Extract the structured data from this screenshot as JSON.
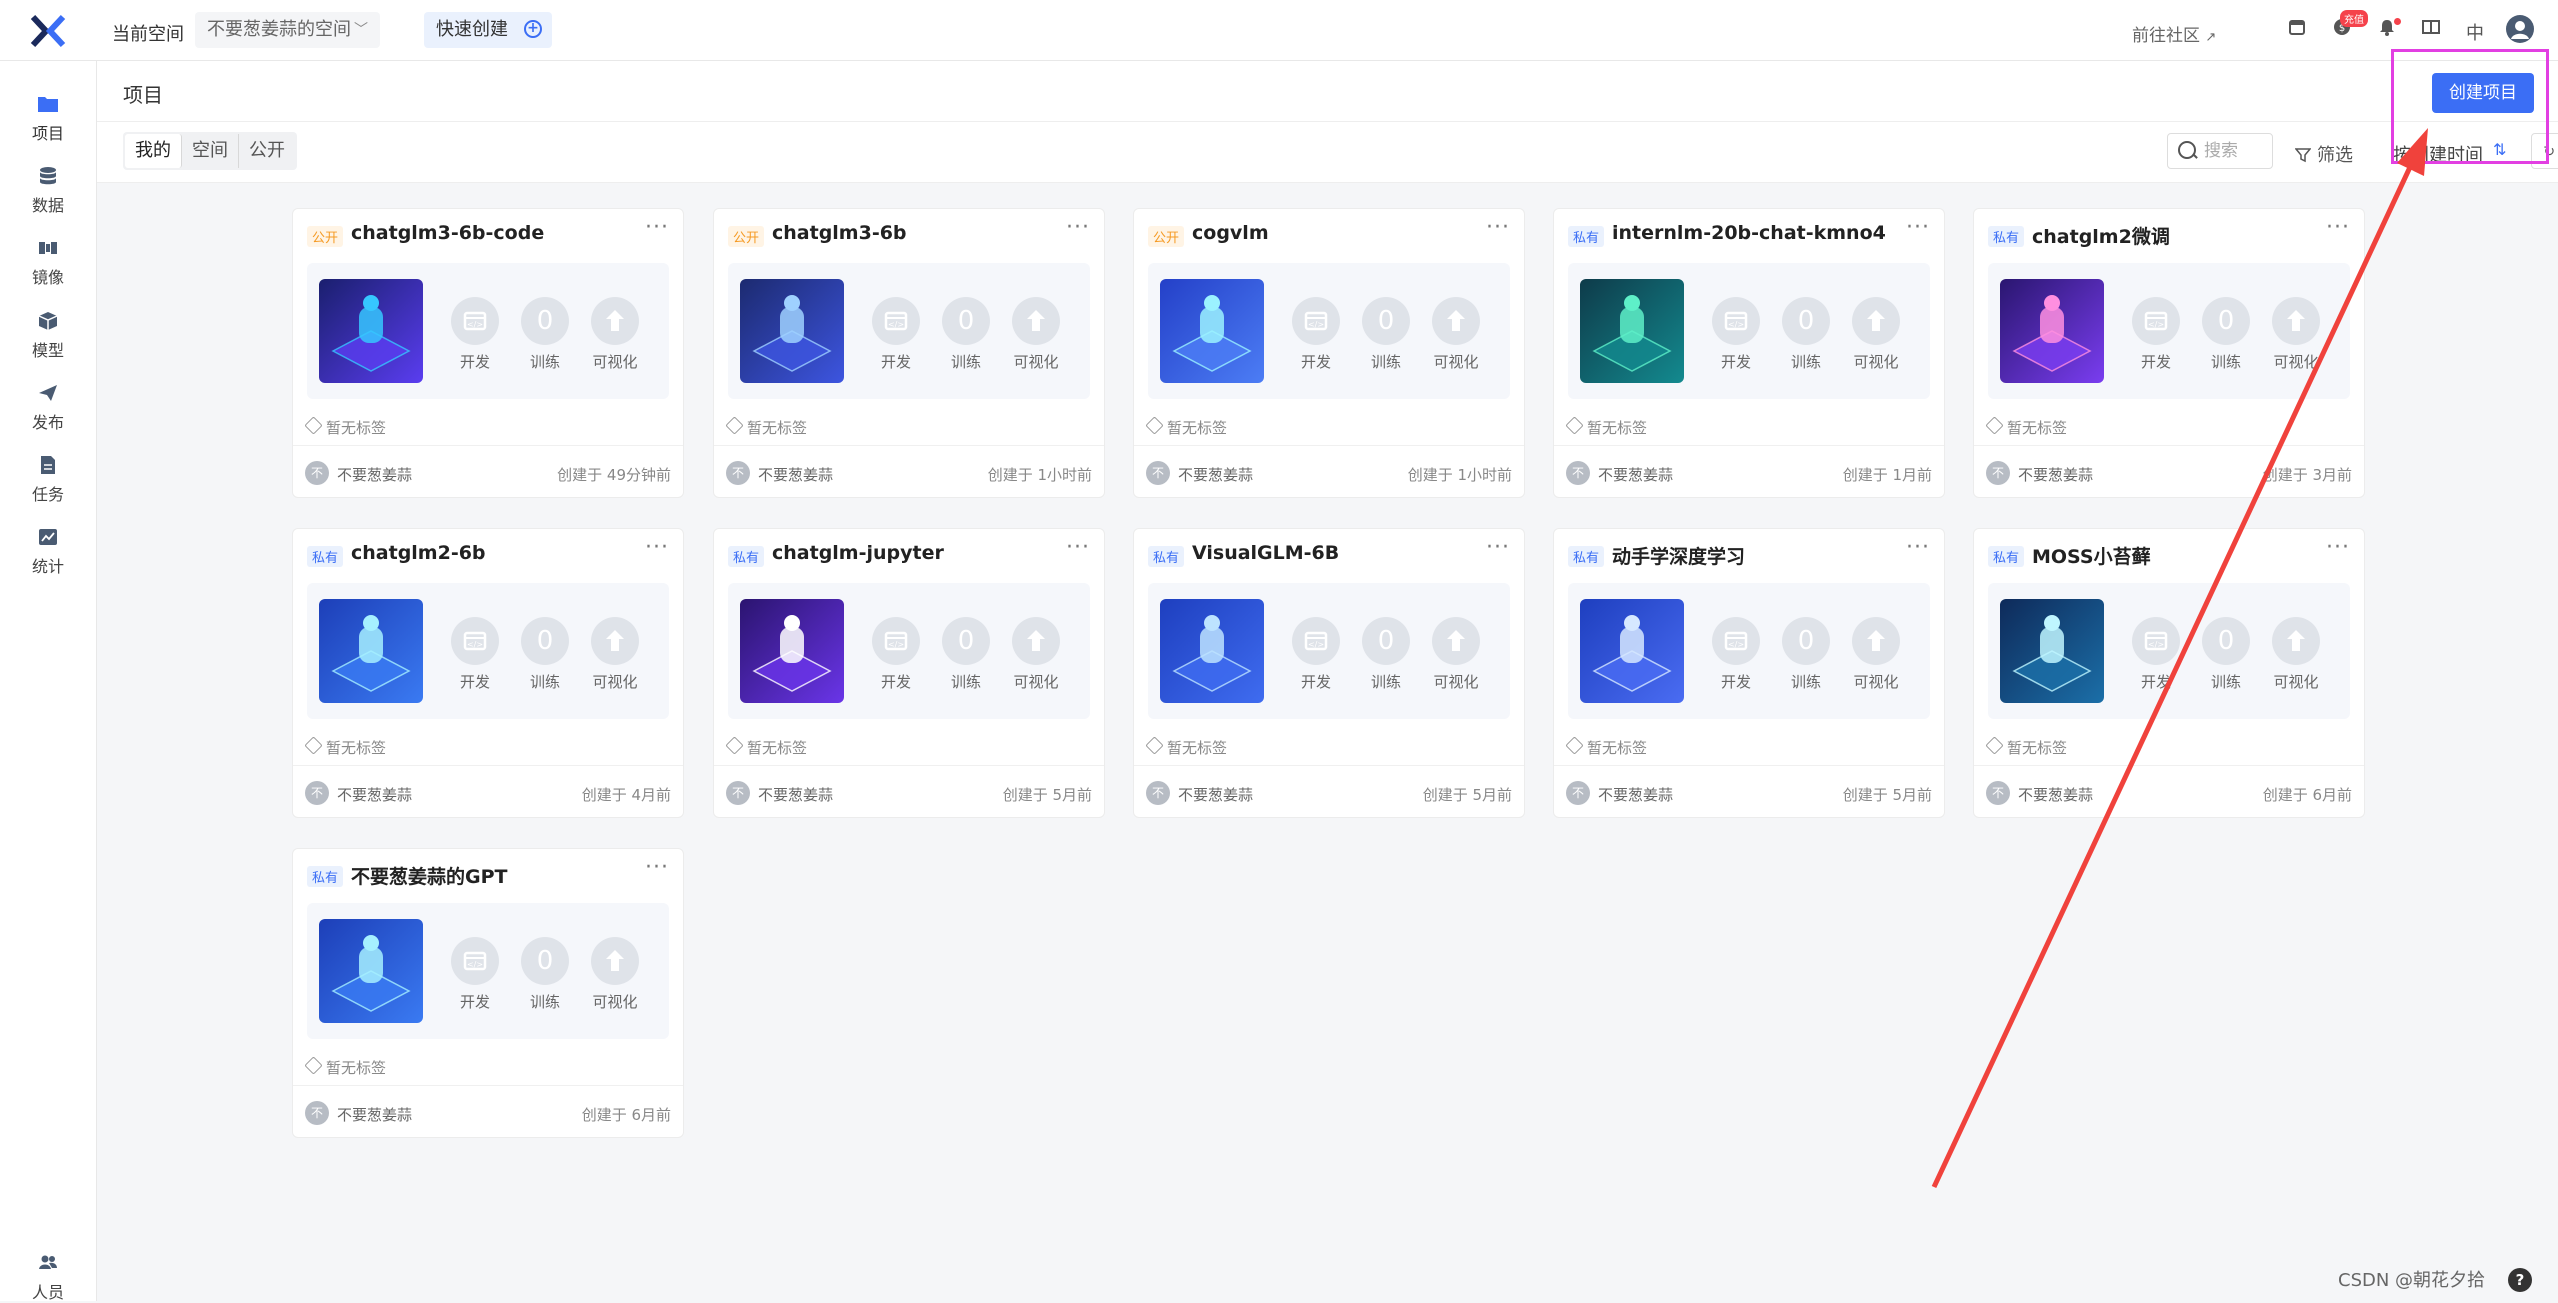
{
  "topbar": {
    "space_label": "当前空间",
    "space_value": "不要葱姜蒜的空间",
    "quick_create": "快速创建",
    "community_link": "前往社区",
    "recharge_badge": "充值",
    "lang": "中"
  },
  "sidebar": {
    "items": [
      {
        "label": "项目",
        "icon": "folder-icon"
      },
      {
        "label": "数据",
        "icon": "database-icon"
      },
      {
        "label": "镜像",
        "icon": "image-icon"
      },
      {
        "label": "模型",
        "icon": "cube-icon"
      },
      {
        "label": "发布",
        "icon": "send-icon"
      },
      {
        "label": "任务",
        "icon": "task-icon"
      },
      {
        "label": "统计",
        "icon": "chart-icon"
      }
    ],
    "people": "人员"
  },
  "header": {
    "title": "项目",
    "create_button": "创建项目"
  },
  "filters": {
    "tabs": [
      "我的",
      "空间",
      "公开"
    ],
    "active_tab": "我的",
    "search_placeholder": "搜索",
    "filter_label": "筛选",
    "sort_label": "按创建时间",
    "refresh_label": "刷新"
  },
  "stat_labels": {
    "dev": "开发",
    "train": "训练",
    "viz": "可视化",
    "train_count": "0"
  },
  "projects": [
    {
      "visibility": "公开",
      "name": "chatglm3-6b-code",
      "tags": "暂无标签",
      "owner": "不要葱姜蒜",
      "owner_initial": "不",
      "created": "创建于 49分钟前"
    },
    {
      "visibility": "公开",
      "name": "chatglm3-6b",
      "tags": "暂无标签",
      "owner": "不要葱姜蒜",
      "owner_initial": "不",
      "created": "创建于 1小时前"
    },
    {
      "visibility": "公开",
      "name": "cogvlm",
      "tags": "暂无标签",
      "owner": "不要葱姜蒜",
      "owner_initial": "不",
      "created": "创建于 1小时前"
    },
    {
      "visibility": "私有",
      "name": "internlm-20b-chat-kmno4",
      "tags": "暂无标签",
      "owner": "不要葱姜蒜",
      "owner_initial": "不",
      "created": "创建于 1月前"
    },
    {
      "visibility": "私有",
      "name": "chatglm2微调",
      "tags": "暂无标签",
      "owner": "不要葱姜蒜",
      "owner_initial": "不",
      "created": "创建于 3月前"
    },
    {
      "visibility": "私有",
      "name": "chatglm2-6b",
      "tags": "暂无标签",
      "owner": "不要葱姜蒜",
      "owner_initial": "不",
      "created": "创建于 4月前"
    },
    {
      "visibility": "私有",
      "name": "chatglm-jupyter",
      "tags": "暂无标签",
      "owner": "不要葱姜蒜",
      "owner_initial": "不",
      "created": "创建于 5月前"
    },
    {
      "visibility": "私有",
      "name": "VisualGLM-6B",
      "tags": "暂无标签",
      "owner": "不要葱姜蒜",
      "owner_initial": "不",
      "created": "创建于 5月前"
    },
    {
      "visibility": "私有",
      "name": "动手学深度学习",
      "tags": "暂无标签",
      "owner": "不要葱姜蒜",
      "owner_initial": "不",
      "created": "创建于 5月前"
    },
    {
      "visibility": "私有",
      "name": "MOSS小苔藓",
      "tags": "暂无标签",
      "owner": "不要葱姜蒜",
      "owner_initial": "不",
      "created": "创建于 6月前"
    },
    {
      "visibility": "私有",
      "name": "不要葱姜蒜的GPT",
      "tags": "暂无标签",
      "owner": "不要葱姜蒜",
      "owner_initial": "不",
      "created": "创建于 6月前"
    }
  ],
  "watermark": "CSDN @朝花夕拾",
  "help": "?",
  "colors": {
    "accent": "#3b6ef5",
    "annotation": "#e23fe2",
    "arrow": "#f0423c"
  }
}
